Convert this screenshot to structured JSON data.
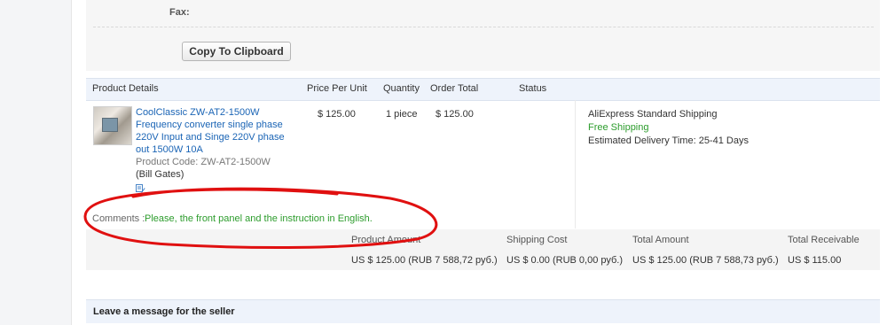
{
  "contact": {
    "fax_label": "Fax:"
  },
  "actions": {
    "copy_label": "Copy To Clipboard"
  },
  "table": {
    "headers": {
      "product_details": "Product Details",
      "price_per_unit": "Price Per Unit",
      "quantity": "Quantity",
      "order_total": "Order Total",
      "status": "Status"
    },
    "item": {
      "name": "CoolClassic ZW-AT2-1500W Frequency converter single phase 220V Input and Singe 220V phase out 1500W 10A",
      "product_code": "Product Code: ZW-AT2-1500W",
      "variant": "(Bill Gates)",
      "price": "$ 125.00",
      "quantity": "1 piece",
      "order_total": "$ 125.00",
      "status": "",
      "shipping": {
        "method": "AliExpress Standard Shipping",
        "cost_label": "Free Shipping",
        "delivery": "Estimated Delivery Time: 25-41 Days"
      }
    }
  },
  "comments": {
    "label": "Comments :",
    "text": "Please, the front panel and the instruction in English."
  },
  "totals": {
    "product_amount_label": "Product Amount",
    "product_amount": "US $ 125.00 (RUB 7 588,72 руб.)",
    "shipping_cost_label": "Shipping Cost",
    "shipping_cost": "US $ 0.00 (RUB 0,00 руб.)",
    "total_amount_label": "Total Amount",
    "total_amount": "US $ 125.00 (RUB 7 588,73 руб.)",
    "total_receivable_label": "Total Receivable",
    "total_receivable": "US $ 115.00"
  },
  "message_section": {
    "title": "Leave a message for the seller"
  },
  "icons": {
    "small": "edit-icon"
  },
  "colors": {
    "link": "#1a64b5",
    "green": "#2c9c2c",
    "annotation": "#e01010"
  }
}
